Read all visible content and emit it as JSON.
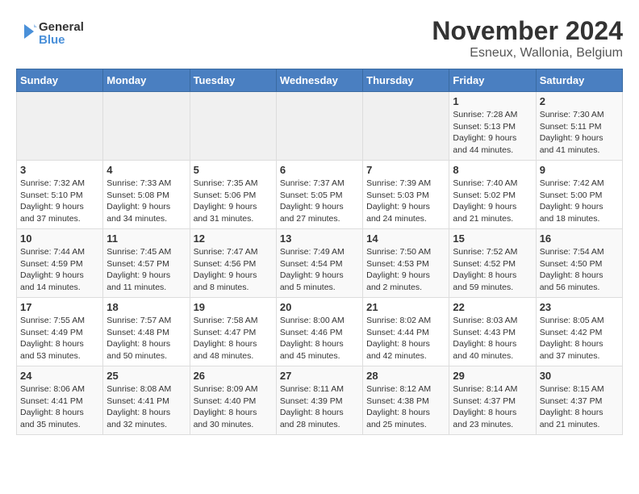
{
  "logo": {
    "line1": "General",
    "line2": "Blue"
  },
  "title": "November 2024",
  "subtitle": "Esneux, Wallonia, Belgium",
  "headers": [
    "Sunday",
    "Monday",
    "Tuesday",
    "Wednesday",
    "Thursday",
    "Friday",
    "Saturday"
  ],
  "weeks": [
    [
      {
        "day": "",
        "info": ""
      },
      {
        "day": "",
        "info": ""
      },
      {
        "day": "",
        "info": ""
      },
      {
        "day": "",
        "info": ""
      },
      {
        "day": "",
        "info": ""
      },
      {
        "day": "1",
        "info": "Sunrise: 7:28 AM\nSunset: 5:13 PM\nDaylight: 9 hours\nand 44 minutes."
      },
      {
        "day": "2",
        "info": "Sunrise: 7:30 AM\nSunset: 5:11 PM\nDaylight: 9 hours\nand 41 minutes."
      }
    ],
    [
      {
        "day": "3",
        "info": "Sunrise: 7:32 AM\nSunset: 5:10 PM\nDaylight: 9 hours\nand 37 minutes."
      },
      {
        "day": "4",
        "info": "Sunrise: 7:33 AM\nSunset: 5:08 PM\nDaylight: 9 hours\nand 34 minutes."
      },
      {
        "day": "5",
        "info": "Sunrise: 7:35 AM\nSunset: 5:06 PM\nDaylight: 9 hours\nand 31 minutes."
      },
      {
        "day": "6",
        "info": "Sunrise: 7:37 AM\nSunset: 5:05 PM\nDaylight: 9 hours\nand 27 minutes."
      },
      {
        "day": "7",
        "info": "Sunrise: 7:39 AM\nSunset: 5:03 PM\nDaylight: 9 hours\nand 24 minutes."
      },
      {
        "day": "8",
        "info": "Sunrise: 7:40 AM\nSunset: 5:02 PM\nDaylight: 9 hours\nand 21 minutes."
      },
      {
        "day": "9",
        "info": "Sunrise: 7:42 AM\nSunset: 5:00 PM\nDaylight: 9 hours\nand 18 minutes."
      }
    ],
    [
      {
        "day": "10",
        "info": "Sunrise: 7:44 AM\nSunset: 4:59 PM\nDaylight: 9 hours\nand 14 minutes."
      },
      {
        "day": "11",
        "info": "Sunrise: 7:45 AM\nSunset: 4:57 PM\nDaylight: 9 hours\nand 11 minutes."
      },
      {
        "day": "12",
        "info": "Sunrise: 7:47 AM\nSunset: 4:56 PM\nDaylight: 9 hours\nand 8 minutes."
      },
      {
        "day": "13",
        "info": "Sunrise: 7:49 AM\nSunset: 4:54 PM\nDaylight: 9 hours\nand 5 minutes."
      },
      {
        "day": "14",
        "info": "Sunrise: 7:50 AM\nSunset: 4:53 PM\nDaylight: 9 hours\nand 2 minutes."
      },
      {
        "day": "15",
        "info": "Sunrise: 7:52 AM\nSunset: 4:52 PM\nDaylight: 8 hours\nand 59 minutes."
      },
      {
        "day": "16",
        "info": "Sunrise: 7:54 AM\nSunset: 4:50 PM\nDaylight: 8 hours\nand 56 minutes."
      }
    ],
    [
      {
        "day": "17",
        "info": "Sunrise: 7:55 AM\nSunset: 4:49 PM\nDaylight: 8 hours\nand 53 minutes."
      },
      {
        "day": "18",
        "info": "Sunrise: 7:57 AM\nSunset: 4:48 PM\nDaylight: 8 hours\nand 50 minutes."
      },
      {
        "day": "19",
        "info": "Sunrise: 7:58 AM\nSunset: 4:47 PM\nDaylight: 8 hours\nand 48 minutes."
      },
      {
        "day": "20",
        "info": "Sunrise: 8:00 AM\nSunset: 4:46 PM\nDaylight: 8 hours\nand 45 minutes."
      },
      {
        "day": "21",
        "info": "Sunrise: 8:02 AM\nSunset: 4:44 PM\nDaylight: 8 hours\nand 42 minutes."
      },
      {
        "day": "22",
        "info": "Sunrise: 8:03 AM\nSunset: 4:43 PM\nDaylight: 8 hours\nand 40 minutes."
      },
      {
        "day": "23",
        "info": "Sunrise: 8:05 AM\nSunset: 4:42 PM\nDaylight: 8 hours\nand 37 minutes."
      }
    ],
    [
      {
        "day": "24",
        "info": "Sunrise: 8:06 AM\nSunset: 4:41 PM\nDaylight: 8 hours\nand 35 minutes."
      },
      {
        "day": "25",
        "info": "Sunrise: 8:08 AM\nSunset: 4:41 PM\nDaylight: 8 hours\nand 32 minutes."
      },
      {
        "day": "26",
        "info": "Sunrise: 8:09 AM\nSunset: 4:40 PM\nDaylight: 8 hours\nand 30 minutes."
      },
      {
        "day": "27",
        "info": "Sunrise: 8:11 AM\nSunset: 4:39 PM\nDaylight: 8 hours\nand 28 minutes."
      },
      {
        "day": "28",
        "info": "Sunrise: 8:12 AM\nSunset: 4:38 PM\nDaylight: 8 hours\nand 25 minutes."
      },
      {
        "day": "29",
        "info": "Sunrise: 8:14 AM\nSunset: 4:37 PM\nDaylight: 8 hours\nand 23 minutes."
      },
      {
        "day": "30",
        "info": "Sunrise: 8:15 AM\nSunset: 4:37 PM\nDaylight: 8 hours\nand 21 minutes."
      }
    ]
  ]
}
